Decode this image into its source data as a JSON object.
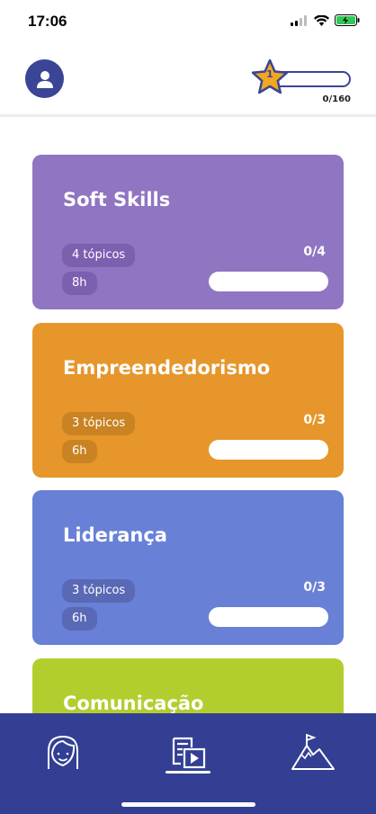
{
  "status": {
    "time": "17:06"
  },
  "header": {
    "level": "1",
    "xp_progress": "0/160",
    "xp_fraction": 0
  },
  "cards": [
    {
      "title": "Soft Skills",
      "topics": "4 tópicos",
      "hours": "8h",
      "count": "0/4",
      "progress": 0,
      "color": "#8f75c2",
      "pill_color": "#7d5fb0"
    },
    {
      "title": "Empreendedorismo",
      "topics": "3 tópicos",
      "hours": "6h",
      "count": "0/3",
      "progress": 0,
      "color": "#e6962a",
      "pill_color": "#c98322"
    },
    {
      "title": "Liderança",
      "topics": "3 tópicos",
      "hours": "6h",
      "count": "0/3",
      "progress": 0,
      "color": "#6880d6",
      "pill_color": "#5969b5"
    },
    {
      "title": "Comunicação",
      "color": "#b2ce2e"
    }
  ],
  "nav": {
    "items": [
      "profile-face-icon",
      "courses-icon",
      "mountain-goal-icon"
    ],
    "active": "courses-icon"
  },
  "colors": {
    "primary": "#3a4595",
    "nav_bg": "#333f93",
    "star": "#f2a81d"
  }
}
